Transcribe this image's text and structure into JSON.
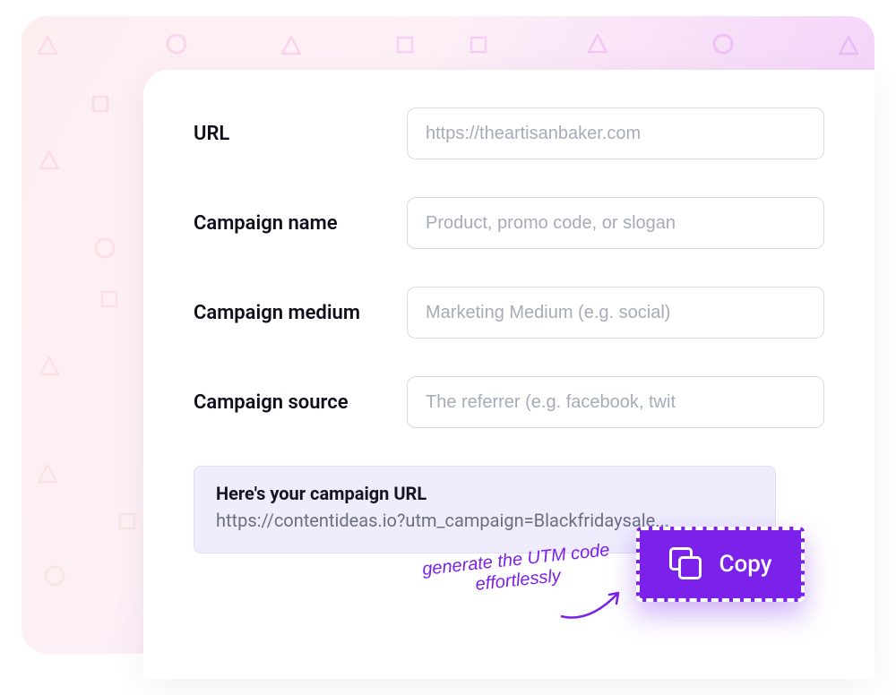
{
  "fields": {
    "url": {
      "label": "URL",
      "placeholder": "https://theartisanbaker.com"
    },
    "campaign_name": {
      "label": "Campaign name",
      "placeholder": "Product, promo code, or slogan"
    },
    "campaign_medium": {
      "label": "Campaign medium",
      "placeholder": "Marketing Medium (e.g. social)"
    },
    "campaign_source": {
      "label": "Campaign source",
      "placeholder": "The referrer (e.g. facebook, twit"
    }
  },
  "result": {
    "title": "Here's your campaign URL",
    "url": "https://contentideas.io?utm_campaign=Blackfridaysale..."
  },
  "copy_button": {
    "label": "Copy"
  },
  "annotation": "generate the UTM code\neffortlessly"
}
